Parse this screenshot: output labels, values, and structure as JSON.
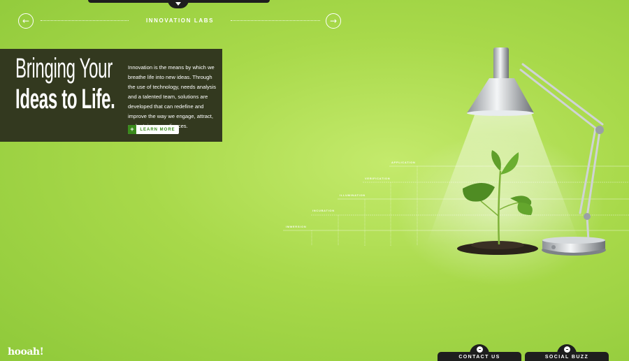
{
  "nav": {
    "title": "INNOVATION LABS",
    "prev_icon": "arrow-left-icon",
    "next_icon": "arrow-right-icon",
    "top_tab_icon": "chevron-down-icon"
  },
  "hero": {
    "heading_line1": "Bringing Your",
    "heading_line2": "Ideas to Life.",
    "body": "Innovation is the means by which we breathe life into new ideas. Through the use of technology, needs analysis and a talented team, solutions are developed that can redefine and improve the way we engage, attract, and retain our audiences.",
    "learn_more_label": "LEARN MORE",
    "learn_more_icon": "plus-icon"
  },
  "illustration": {
    "stages": [
      "IMMERSION",
      "INCUBATION",
      "ILLUMINATION",
      "VERIFICATION",
      "APPLICATION"
    ]
  },
  "footer": {
    "logo_text": "hooah!",
    "contact_label": "CONTACT US",
    "social_label": "SOCIAL BUZZ"
  },
  "colors": {
    "background": "#a8d94a",
    "panel": "#33391f",
    "accent_green": "#3a8a1c",
    "tab_dark": "#1e1e1e"
  }
}
